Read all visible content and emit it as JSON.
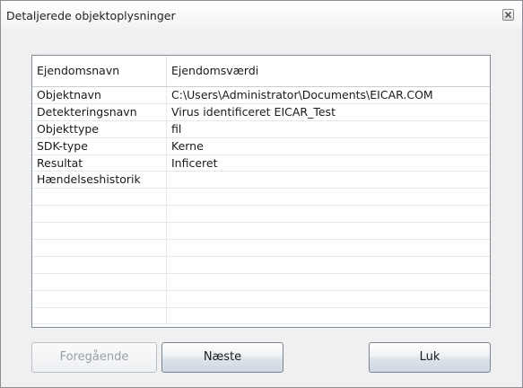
{
  "window": {
    "title": "Detaljerede objektoplysninger",
    "close_icon": "close-x-icon"
  },
  "table": {
    "columns": [
      "Ejendomsnavn",
      "Ejendomsværdi"
    ],
    "rows": [
      {
        "name": "Objektnavn",
        "value": "C:\\Users\\Administrator\\Documents\\EICAR.COM"
      },
      {
        "name": "Detekteringsnavn",
        "value": "Virus identificeret EICAR_Test"
      },
      {
        "name": "Objekttype",
        "value": "fil"
      },
      {
        "name": "SDK-type",
        "value": "Kerne"
      },
      {
        "name": "Resultat",
        "value": "Inficeret"
      },
      {
        "name": "Hændelseshistorik",
        "value": ""
      },
      {
        "name": "",
        "value": ""
      },
      {
        "name": "",
        "value": ""
      },
      {
        "name": "",
        "value": ""
      },
      {
        "name": "",
        "value": ""
      },
      {
        "name": "",
        "value": ""
      },
      {
        "name": "",
        "value": ""
      },
      {
        "name": "",
        "value": ""
      },
      {
        "name": "",
        "value": ""
      }
    ]
  },
  "buttons": {
    "previous": "Foregående",
    "next": "Næste",
    "close": "Luk"
  }
}
